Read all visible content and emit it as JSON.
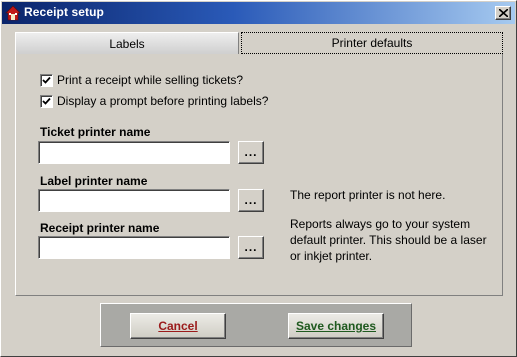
{
  "window": {
    "title": "Receipt setup",
    "close_glyph": "×"
  },
  "tabs": [
    {
      "label": "Labels",
      "active": false
    },
    {
      "label": "Printer defaults",
      "active": true
    }
  ],
  "options": [
    {
      "label": "Print a receipt while selling tickets?",
      "checked": true
    },
    {
      "label": "Display a prompt before printing labels?",
      "checked": true
    }
  ],
  "fields": {
    "ticket_printer": {
      "label": "Ticket printer name",
      "value": "",
      "browse_label": "..."
    },
    "label_printer": {
      "label": "Label printer name",
      "value": "",
      "browse_label": "..."
    },
    "receipt_printer": {
      "label": "Receipt printer name",
      "value": "",
      "browse_label": "..."
    }
  },
  "notes": {
    "line1": "The report printer is not here.",
    "line2": "Reports always go to your system default printer. This should be a laser or inkjet printer."
  },
  "footer": {
    "cancel_label": "Cancel",
    "save_label": "Save changes"
  },
  "colors": {
    "title_gradient_start": "#0a246a",
    "title_gradient_end": "#a6caf0",
    "cancel_text": "#9b1b1b",
    "save_text": "#1f5a1f",
    "dialog_face": "#d4d0c8"
  },
  "icons": {
    "title_icon": "app-house-icon",
    "close_icon": "close-x-icon",
    "check_icon": "checkmark-icon"
  }
}
